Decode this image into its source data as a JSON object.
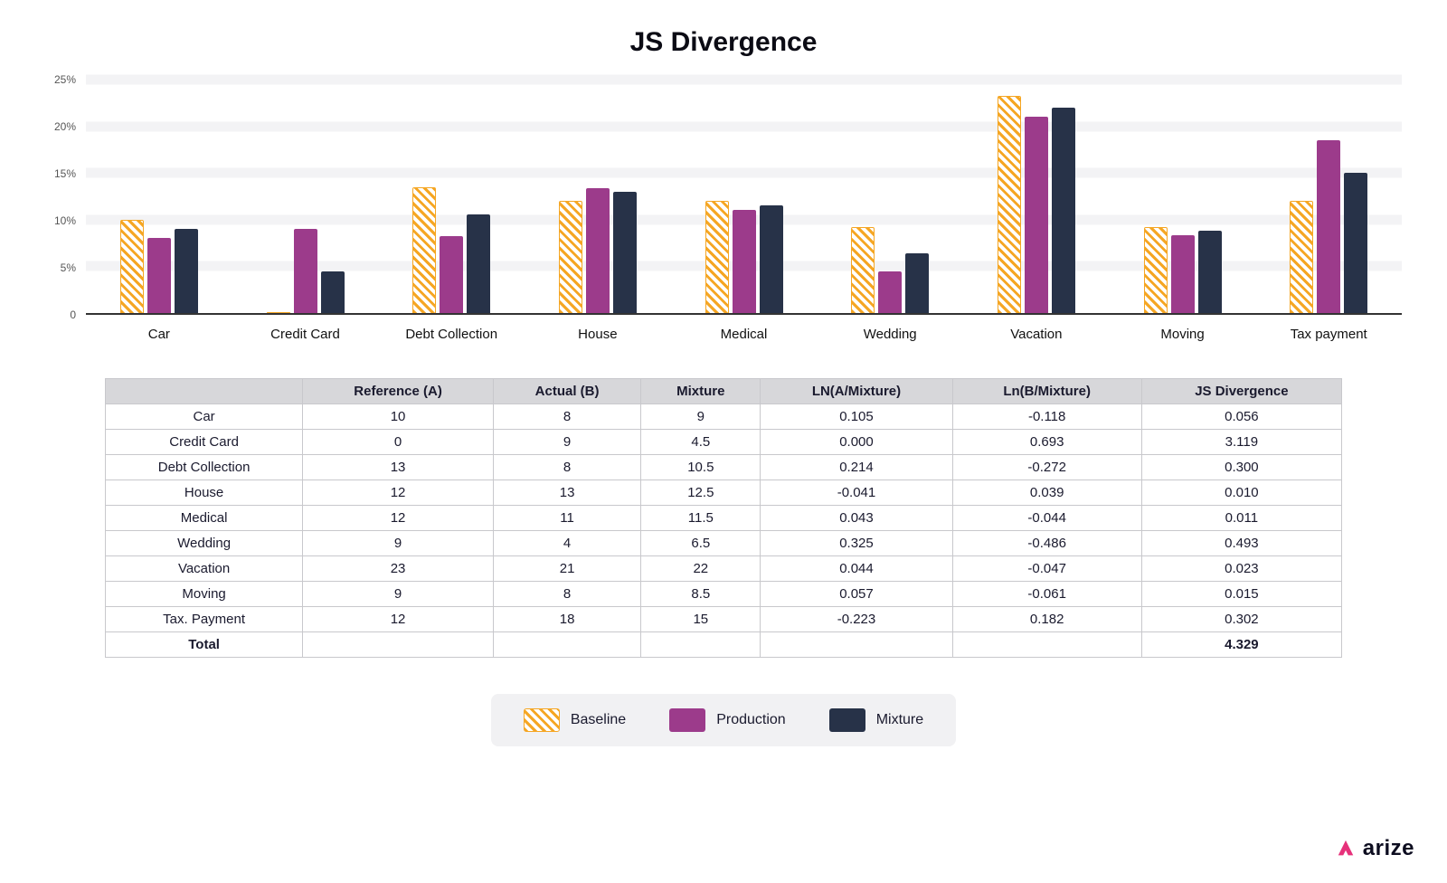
{
  "title": "JS Divergence",
  "brand": "arize",
  "legend": {
    "baseline": "Baseline",
    "production": "Production",
    "mixture": "Mixture"
  },
  "chart_data": {
    "type": "bar",
    "title": "JS Divergence",
    "xlabel": "",
    "ylabel": "",
    "ylim": [
      0,
      25
    ],
    "yticks": [
      0,
      5,
      10,
      15,
      20,
      25
    ],
    "ytick_labels": [
      "0",
      "5%",
      "10%",
      "15%",
      "20%",
      "25%"
    ],
    "categories": [
      "Car",
      "Credit Card",
      "Debt Collection",
      "House",
      "Medical",
      "Wedding",
      "Vacation",
      "Moving",
      "Tax payment"
    ],
    "series": [
      {
        "name": "Baseline",
        "values": [
          10.0,
          0.0,
          13.5,
          12.0,
          12.0,
          9.2,
          23.3,
          9.2,
          12.0
        ]
      },
      {
        "name": "Production",
        "values": [
          8.0,
          9.0,
          8.2,
          13.4,
          11.0,
          4.5,
          21.0,
          8.3,
          18.5
        ]
      },
      {
        "name": "Mixture",
        "values": [
          9.0,
          4.5,
          10.6,
          13.0,
          11.5,
          6.4,
          22.0,
          8.8,
          15.0
        ]
      }
    ],
    "legend_position": "bottom",
    "grid": true
  },
  "table": {
    "headers": [
      "",
      "Reference (A)",
      "Actual (B)",
      "Mixture",
      "LN(A/Mixture)",
      "Ln(B/Mixture)",
      "JS Divergence"
    ],
    "rows": [
      [
        "Car",
        "10",
        "8",
        "9",
        "0.105",
        "-0.118",
        "0.056"
      ],
      [
        "Credit Card",
        "0",
        "9",
        "4.5",
        "0.000",
        "0.693",
        "3.119"
      ],
      [
        "Debt Collection",
        "13",
        "8",
        "10.5",
        "0.214",
        "-0.272",
        "0.300"
      ],
      [
        "House",
        "12",
        "13",
        "12.5",
        "-0.041",
        "0.039",
        "0.010"
      ],
      [
        "Medical",
        "12",
        "11",
        "11.5",
        "0.043",
        "-0.044",
        "0.011"
      ],
      [
        "Wedding",
        "9",
        "4",
        "6.5",
        "0.325",
        "-0.486",
        "0.493"
      ],
      [
        "Vacation",
        "23",
        "21",
        "22",
        "0.044",
        "-0.047",
        "0.023"
      ],
      [
        "Moving",
        "9",
        "8",
        "8.5",
        "0.057",
        "-0.061",
        "0.015"
      ],
      [
        "Tax. Payment",
        "12",
        "18",
        "15",
        "-0.223",
        "0.182",
        "0.302"
      ]
    ],
    "total_row": [
      "Total",
      "",
      "",
      "",
      "",
      "",
      "4.329"
    ]
  }
}
